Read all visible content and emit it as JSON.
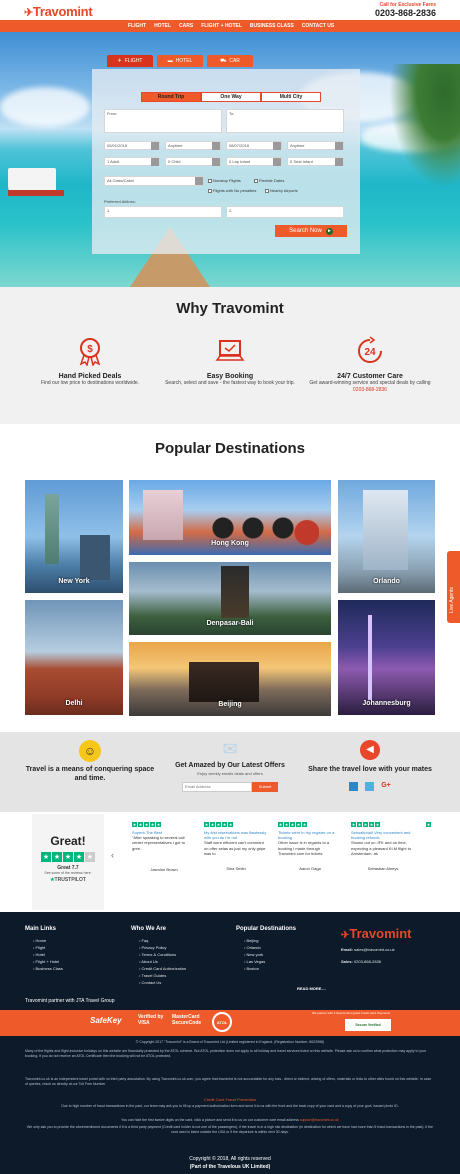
{
  "brand": {
    "logo": "Travomint",
    "call_label": "Call for Exclusive Fares",
    "phone": "0203-868-2836"
  },
  "nav": [
    "FLIGHT",
    "HOTEL",
    "CARS",
    "FLIGHT + HOTEL",
    "BUSINESS CLASS",
    "CONTACT US"
  ],
  "search": {
    "tabs": [
      "FLIGHT",
      "HOTEL",
      "CAR"
    ],
    "trip_types": [
      "Round Trip",
      "One Way",
      "Multi City"
    ],
    "from_label": "From:",
    "to_label": "To:",
    "depart_date": "05/01/2018",
    "depart_time": "Anytime",
    "return_date": "08/07/2018",
    "return_time": "Anytime",
    "adults": "1 Adult",
    "children": "0 Child",
    "infant_lap": "0 Lap Infant",
    "infant_seat": "0 Seat Infant",
    "cabin": "All Class/Cabin",
    "nonstop": "Nonstop Flights",
    "flexible": "Flexible Dates",
    "nearby_from": "Flights with No penalties",
    "nearby_to": "Nearby Airports",
    "preferred_label": "Preferred Airlines:",
    "airline_1": "1.",
    "airline_2": "2.",
    "button": "Search Now"
  },
  "why": {
    "title": "Why Travomint",
    "features": [
      {
        "title": "Hand Picked Deals",
        "desc": "Find our low price to destinations worldwide."
      },
      {
        "title": "Easy Booking",
        "desc": "Search, select and save - the fastest way to book your trip."
      },
      {
        "title": "24/7 Customer Care",
        "desc": "Get award-winning service and special deals by calling",
        "phone": "0203-868-2836"
      }
    ],
    "care_icon_text": "24"
  },
  "destinations": {
    "title": "Popular Destinations",
    "items": [
      "New York",
      "Hong Kong",
      "Orlando",
      "Denpasar-Bali",
      "Delhi",
      "Beijing",
      "Johannesburg"
    ]
  },
  "band": {
    "quote": "Travel is a means of conquering space and time.",
    "newsletter_title": "Get Amazed by Our Latest Offers",
    "newsletter_sub": "Enjoy weekly emails deals and offers",
    "email_placeholder": "Email Address",
    "submit": "Submit",
    "share_title": "Share the travel love with your mates"
  },
  "reviews": {
    "headline": "Great!",
    "score": "Great 7.7",
    "sub": "See some of the reviews here.",
    "brand": "TRUSTPILOT",
    "cards": [
      {
        "title": "Superb The Best",
        "text": "\"After speaking to several call center representatives I got to gree..",
        "author": "Jasmine Brown"
      },
      {
        "title": "My first reservations was flawlessly with you as I'm not",
        "text": "Staff were efficient can't comment on offer selas as just my only gripe was to",
        "author": "Sina Smith"
      },
      {
        "title": "Tickets were in my register on a booking",
        "text": "Other issue is in regards to a booking I made through Travomint.com for tickets",
        "author": "Aaron Gaga"
      },
      {
        "title": "Sensational! Very convenient and booking refunds",
        "text": "Shown out on JFK and on time, expecting a pleasant KLM flight to Amsterdam. as",
        "author": "Sebastian Alneys"
      }
    ]
  },
  "footer": {
    "main_links_title": "Main Links",
    "main_links": [
      "Home",
      "Flight",
      "Hotel",
      "Flight + Hotel",
      "Business Class"
    ],
    "who_title": "Who We Are",
    "who_links": [
      "Faq",
      "Privacy Policy",
      "Terms & Conditions",
      "About Us",
      "Credit Card Authorization",
      "Travel Guides",
      "Contact Us"
    ],
    "popular_title": "Popular Destinations",
    "popular_links": [
      "Beijing",
      "Orlando",
      "New york",
      "Las Vegas",
      "Boston"
    ],
    "read_more": "READ MORE....",
    "logo": "Travomint",
    "email_label": "Email:",
    "email": "sales@travomint.co.uk",
    "sales_label": "Sales:",
    "sales": "0203-868-2836",
    "partner": "Travomint partner with JTA Travel Group"
  },
  "payments": {
    "safekey": "SafeKey",
    "visa": "Verified by VISA",
    "mastercard": "MasterCard SecureCode",
    "atol": "ATOL",
    "secure_note": "We partner with it Secure Encrypted Credit Card Payments",
    "badge": "Secure Verified"
  },
  "fine_print": {
    "copyright": "© Copyright 2017 \"Travomint\" is a Brand of Travomint Ltd (Limited registered in England. (Registration Number: 8623988)",
    "atol": "Many of the flights and flight-inclusive holidays on this website are financially protected by the ATOL scheme. But ATOL protection does not apply to all holiday and travel services listed on this website. Please ask us to confirm what protection may apply to your booking. If you do not receive an ATOL Certificate then the booking will not be ATOL protected.",
    "disclaimer": "Travomint.co.uk is an independent travel portal with no third party association. By using Travomint.co.uk.com, you agree that travomint is not accountable for any loss - direct or indirect, arising of offers, materials or links to other sites found on this website. In case of queries, reach us directly at our Toll Free Number",
    "fraud_title": "Credit Card Fraud Prevention",
    "fraud": "Due to high number of fraud transactions in the past, our team may ask you to fill up a payment authorization form and send it to us with the front and the back copy of your card and a copy of your govt. issued photo ID.",
    "fraud2": "You can hide the first twelve digits on the card, click a picture and send it to us on our customer care email address",
    "fraud_email": "support@travomint.co.uk",
    "fraud3": "We only ask you to provide the aforementioned documents if it is a third party payment (Credit card holder is not one of the passengers), if the travel is in a high risk destination (in destination for which we have had more than 5 fraud transactions in the past), if the card used is listed outside the USA or if the departure is within next 30 days.",
    "bottom1": "Copyright © 2018, All rights reserved",
    "bottom2": "(Part of the Travelous UK Limited)"
  },
  "live_agents": "Live Agents",
  "colors": {
    "accent": "#ef5a2b",
    "footer": "#0c1a2a",
    "trustpilot": "#00b67a"
  }
}
